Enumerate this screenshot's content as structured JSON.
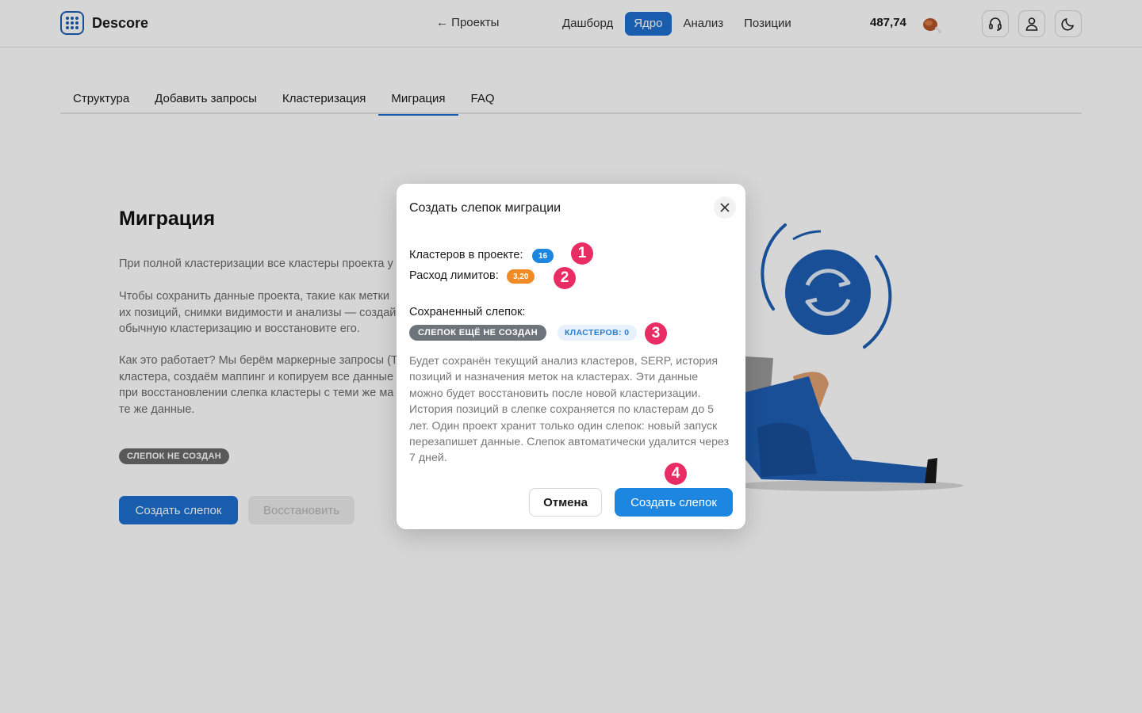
{
  "header": {
    "logo_text": "Descore",
    "back_link": "← Проекты",
    "nav": [
      {
        "label": "Дашборд",
        "active": false
      },
      {
        "label": "Ядро",
        "active": true
      },
      {
        "label": "Анализ",
        "active": false
      },
      {
        "label": "Позиции",
        "active": false
      }
    ],
    "balance": "487,74",
    "icons": [
      "coin-icon",
      "headset-icon",
      "user-icon",
      "moon-icon"
    ]
  },
  "tabs": [
    {
      "label": "Структура",
      "active": false
    },
    {
      "label": "Добавить запросы",
      "active": false
    },
    {
      "label": "Кластеризация",
      "active": false
    },
    {
      "label": "Миграция",
      "active": true
    },
    {
      "label": "FAQ",
      "active": false
    }
  ],
  "page": {
    "title": "Миграция",
    "paragraphs": [
      [
        "При полной кластеризации все кластеры проекта у"
      ],
      [
        "Чтобы сохранить данные проекта, такие как метки",
        "их позиций, снимки видимости и анализы — создай",
        "обычную кластеризацию и восстановите его."
      ],
      [
        "Как это работает? Мы берём маркерные запросы (Т",
        "кластера, создаём маппинг и копируем все данные",
        "при восстановлении слепка кластеры с теми же ма",
        "те же данные."
      ]
    ],
    "status_badge": "СЛЕПОК НЕ СОЗДАН",
    "create_button": "Создать слепок",
    "restore_button": "Восстановить"
  },
  "modal": {
    "title": "Создать слепок миграции",
    "clusters_label": "Кластеров в проекте:",
    "clusters_value": "16",
    "limits_label": "Расход лимитов:",
    "limits_value": "3,20",
    "snapshot_label": "Сохраненный слепок:",
    "snapshot_status": "СЛЕПОК ЕЩЁ НЕ СОЗДАН",
    "snapshot_clusters": "КЛАСТЕРОВ: 0",
    "description": "Будет сохранён текущий анализ кластеров, SERP, история позиций и назначения меток на кластерах. Эти данные можно будет восстановить после новой кластеризации. История позиций в слепке сохраняется по кластерам до 5 лет. Один проект хранит только один слепок: новый запуск перезапишет данные. Слепок автоматически удалится через 7 дней.",
    "cancel_button": "Отмена",
    "create_button": "Создать слепок"
  },
  "markers": [
    "1",
    "2",
    "3",
    "4"
  ],
  "colors": {
    "primary": "#1d86e0",
    "orange": "#f08a24",
    "marker": "#ea2c64"
  }
}
